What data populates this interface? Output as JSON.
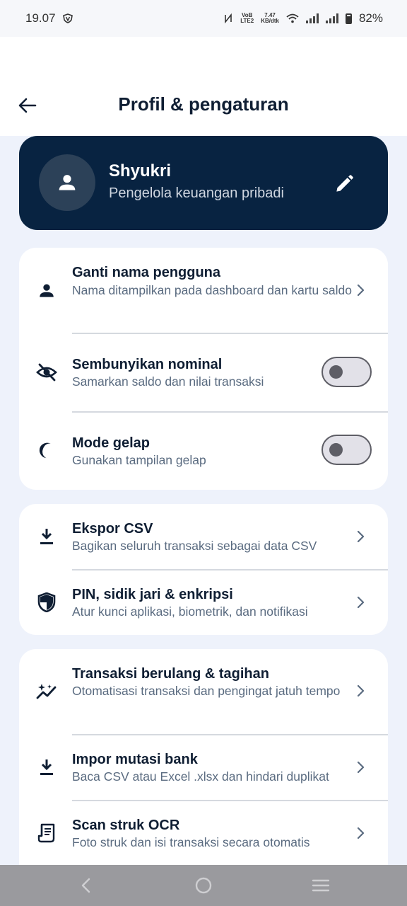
{
  "status_bar": {
    "time": "19.07",
    "network_top": "VoB",
    "network_bottom": "LTE2",
    "speed_value": "7.47",
    "speed_unit": "KB/dtk",
    "battery": "82%"
  },
  "header": {
    "title": "Profil & pengaturan"
  },
  "profile": {
    "name": "Shyukri",
    "subtitle": "Pengelola keuangan pribadi"
  },
  "groups": {
    "account": {
      "rename": {
        "title": "Ganti nama pengguna",
        "description": "Nama ditampilkan pada dashboard dan kartu saldo",
        "icon": "person-icon"
      },
      "hide_amounts": {
        "title": "Sembunyikan nominal",
        "description": "Samarkan saldo dan nilai transaksi",
        "icon": "eye-off-icon",
        "enabled": false
      },
      "dark_mode": {
        "title": "Mode gelap",
        "description": "Gunakan tampilan gelap",
        "icon": "moon-icon",
        "enabled": false
      }
    },
    "data_security": {
      "export_csv": {
        "title": "Ekspor CSV",
        "description": "Bagikan seluruh transaksi sebagai data CSV",
        "icon": "download-icon"
      },
      "security": {
        "title": "PIN, sidik jari & enkripsi",
        "description": "Atur kunci aplikasi, biometrik, dan notifikasi",
        "icon": "shield-icon"
      }
    },
    "automation": {
      "recurring": {
        "title": "Transaksi berulang & tagihan",
        "description": "Otomatisasi transaksi dan pengingat jatuh tempo",
        "icon": "auto-graph-icon"
      },
      "import_bank": {
        "title": "Impor mutasi bank",
        "description": "Baca CSV atau Excel .xlsx dan hindari duplikat",
        "icon": "download-icon"
      },
      "scan_receipt": {
        "title": "Scan struk OCR",
        "description": "Foto struk dan isi transaksi secara otomatis",
        "icon": "receipt-icon"
      }
    }
  },
  "colors": {
    "background": "#eef2fb",
    "card_dark": "#082341",
    "text_primary": "#0f1e33",
    "text_secondary": "#5a6b80"
  }
}
